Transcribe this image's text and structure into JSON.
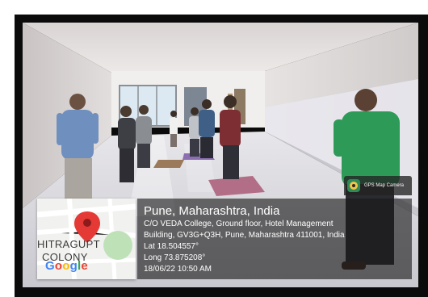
{
  "map": {
    "place_line_1": "HITRAGUPT",
    "place_line_2": "COLONY",
    "logo_letters": [
      {
        "char": "G",
        "color": "#4285F4"
      },
      {
        "char": "o",
        "color": "#EA4335"
      },
      {
        "char": "o",
        "color": "#FBBC05"
      },
      {
        "char": "g",
        "color": "#4285F4"
      },
      {
        "char": "l",
        "color": "#34A853"
      },
      {
        "char": "e",
        "color": "#EA4335"
      }
    ],
    "pin_icon": "map-pin-icon",
    "pin_color": "#E53935"
  },
  "gps_tag": {
    "label": "GPS Map Camera",
    "icon": "gps-map-camera-icon"
  },
  "info": {
    "title": "Pune, Maharashtra, India",
    "address_line_1": "C/O VEDA College, Ground floor, Hotel Management",
    "address_line_2": "Building, GV3G+Q3H, Pune, Maharashtra 411001, India",
    "lat": "Lat 18.504557°",
    "long": "Long 73.875208°",
    "datetime": "18/06/22 10:50 AM"
  },
  "colors": {
    "frame": "#0b0b0b",
    "overlay": "#191919"
  }
}
